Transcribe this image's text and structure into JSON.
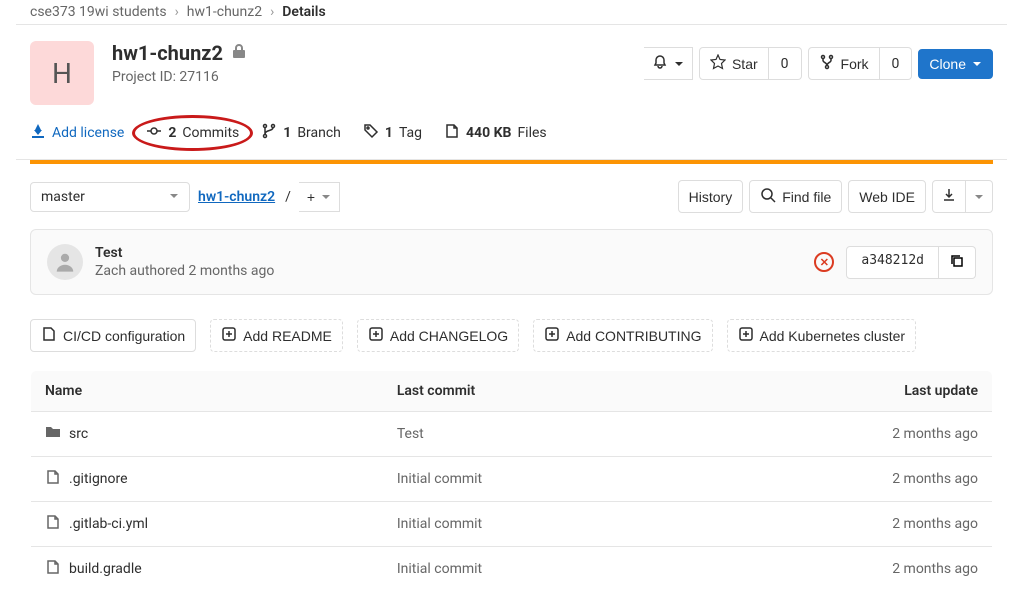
{
  "breadcrumb": {
    "items": [
      "cse373 19wi students",
      "hw1-chunz2"
    ],
    "current": "Details"
  },
  "project": {
    "name": "hw1-chunz2",
    "avatar_letter": "H",
    "id_label": "Project ID: 27116"
  },
  "header_actions": {
    "star_label": "Star",
    "star_count": "0",
    "fork_label": "Fork",
    "fork_count": "0",
    "clone_label": "Clone"
  },
  "stats": {
    "add_license": "Add license",
    "commits_count": "2",
    "commits_label": "Commits",
    "branch_count": "1",
    "branch_label": "Branch",
    "tag_count": "1",
    "tag_label": "Tag",
    "size": "440 KB",
    "size_label": "Files"
  },
  "controls": {
    "branch": "master",
    "path_root": "hw1-chunz2",
    "path_sep": "/",
    "plus": "+",
    "history": "History",
    "find_file": "Find file",
    "web_ide": "Web IDE"
  },
  "commit": {
    "title": "Test",
    "authored_by": "Zach authored 2 months ago",
    "status_symbol": "✕",
    "sha": "a348212d"
  },
  "actions": {
    "cicd": "CI/CD configuration",
    "readme": "Add README",
    "changelog": "Add CHANGELOG",
    "contributing": "Add CONTRIBUTING",
    "kubernetes": "Add Kubernetes cluster"
  },
  "table": {
    "headers": {
      "name": "Name",
      "commit": "Last commit",
      "update": "Last update"
    },
    "rows": [
      {
        "type": "folder",
        "name": "src",
        "commit": "Test",
        "update": "2 months ago"
      },
      {
        "type": "file",
        "name": ".gitignore",
        "commit": "Initial commit",
        "update": "2 months ago"
      },
      {
        "type": "file",
        "name": ".gitlab-ci.yml",
        "commit": "Initial commit",
        "update": "2 months ago"
      },
      {
        "type": "file",
        "name": "build.gradle",
        "commit": "Initial commit",
        "update": "2 months ago"
      }
    ]
  }
}
